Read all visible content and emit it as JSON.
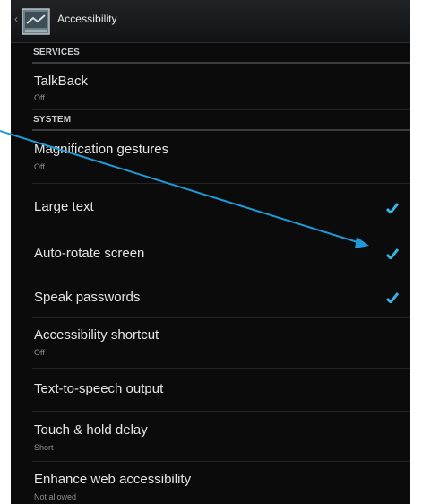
{
  "app_bar": {
    "title": "Accessibility",
    "back_glyph": "‹",
    "icon": "accessibility-app-icon"
  },
  "sections": [
    {
      "header": "SERVICES"
    },
    {
      "header": "SYSTEM"
    }
  ],
  "items": [
    {
      "title": "TalkBack",
      "summary": "Off"
    },
    {
      "title": "Magnification gestures",
      "summary": "Off"
    },
    {
      "title": "Large text",
      "checked": true
    },
    {
      "title": "Auto-rotate screen",
      "checked": true
    },
    {
      "title": "Speak passwords",
      "checked": true
    },
    {
      "title": "Accessibility shortcut",
      "summary": "Off"
    },
    {
      "title": "Text-to-speech output"
    },
    {
      "title": "Touch & hold delay",
      "summary": "Short"
    },
    {
      "title": "Enhance web accessibility",
      "summary": "Not allowed"
    }
  ],
  "colors": {
    "accent": "#33b5e5",
    "background": "#0b0b0c",
    "arrow": "#1e9ad6"
  }
}
